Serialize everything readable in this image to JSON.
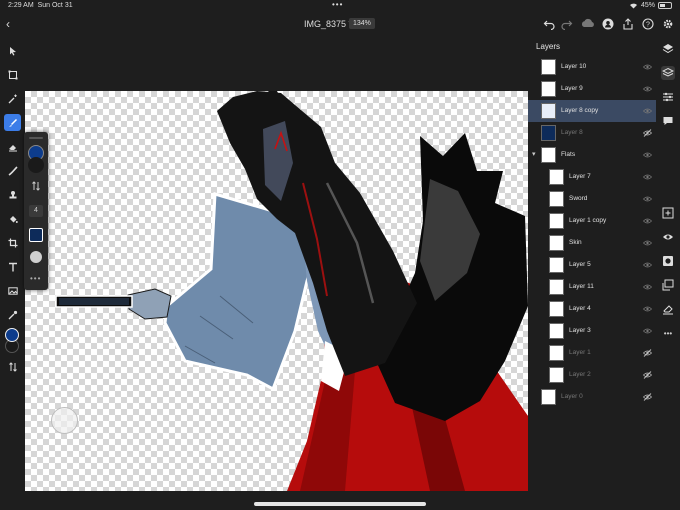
{
  "status": {
    "time": "2:29 AM",
    "date": "Sun Oct 31",
    "battery": "45%"
  },
  "document": {
    "title": "IMG_8375 *",
    "zoom": "134%"
  },
  "brush_panel": {
    "size_value": "4",
    "color": "#0d2b5a"
  },
  "layers": {
    "title": "Layers",
    "items": [
      {
        "name": "Layer 10",
        "visible": true,
        "selected": false,
        "indent": false
      },
      {
        "name": "Layer 9",
        "visible": true,
        "selected": false,
        "indent": false
      },
      {
        "name": "Layer 8 copy",
        "visible": true,
        "selected": true,
        "indent": false
      },
      {
        "name": "Layer 8",
        "visible": false,
        "selected": false,
        "indent": false
      },
      {
        "name": "Flats",
        "visible": true,
        "selected": false,
        "indent": false,
        "group": true
      },
      {
        "name": "Layer 7",
        "visible": true,
        "selected": false,
        "indent": true
      },
      {
        "name": "Sword",
        "visible": true,
        "selected": false,
        "indent": true
      },
      {
        "name": "Layer 1 copy",
        "visible": true,
        "selected": false,
        "indent": true
      },
      {
        "name": "Skin",
        "visible": true,
        "selected": false,
        "indent": true
      },
      {
        "name": "Layer 5",
        "visible": true,
        "selected": false,
        "indent": true
      },
      {
        "name": "Layer 11",
        "visible": true,
        "selected": false,
        "indent": true
      },
      {
        "name": "Layer 4",
        "visible": true,
        "selected": false,
        "indent": true
      },
      {
        "name": "Layer 3",
        "visible": true,
        "selected": false,
        "indent": true
      },
      {
        "name": "Layer 1",
        "visible": false,
        "selected": false,
        "indent": true
      },
      {
        "name": "Layer 2",
        "visible": false,
        "selected": false,
        "indent": true
      },
      {
        "name": "Layer 0",
        "visible": false,
        "selected": false,
        "indent": false
      }
    ]
  },
  "colors": {
    "accent": "#3c7de8",
    "primary_swatch": "#0d3c8c",
    "secondary_swatch": "#1a1a1a",
    "selected_row": "#3b4a63"
  },
  "icons": {
    "left": [
      "select-arrow-icon",
      "transform-icon",
      "magic-wand-icon",
      "brush-icon",
      "eraser-icon",
      "smudge-icon",
      "clone-stamp-icon",
      "paint-bucket-icon",
      "crop-icon",
      "text-icon",
      "image-icon",
      "eyedropper-icon",
      "swap-colors-icon"
    ],
    "right": [
      "layers-icon",
      "layer-properties-icon",
      "adjustments-icon",
      "comments-icon",
      "add-layer-icon",
      "visibility-icon",
      "mask-icon",
      "merge-down-icon",
      "clear-icon",
      "more-icon"
    ]
  }
}
